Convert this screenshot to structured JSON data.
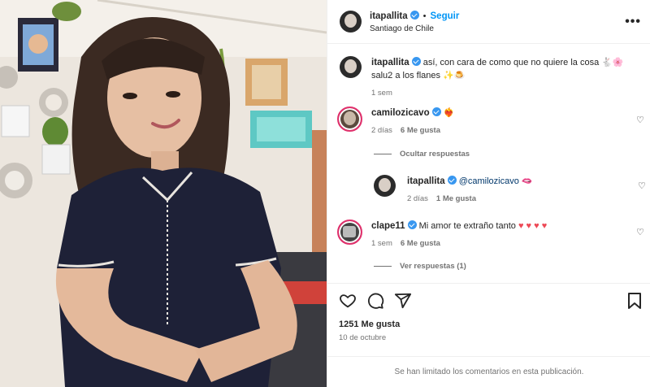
{
  "post": {
    "username": "itapallita",
    "follow_label": "Seguir",
    "location": "Santiago de Chile",
    "more_label": "•••"
  },
  "caption": {
    "username": "itapallita",
    "text_line1": "así, con cara de como que no quiere la cosa 🐇🌸",
    "text_line2": "salu2 a los flanes ✨🍮",
    "time": "1 sem"
  },
  "comments": [
    {
      "username": "camilozicavo",
      "text": "❤️‍🔥",
      "time": "2 días",
      "likes": "6 Me gusta",
      "replies_label": "Ocultar respuestas"
    },
    {
      "username": "itapallita",
      "mention": "@camilozicavo",
      "text": "🫦",
      "time": "2 días",
      "likes": "1 Me gusta"
    },
    {
      "username": "clape11",
      "text": "Mi amor te extraño tanto",
      "hearts": "♥ ♥ ♥ ♥",
      "time": "1 sem",
      "likes": "6 Me gusta",
      "replies_label": "Ver respuestas (1)"
    }
  ],
  "footer": {
    "likes": "1251 Me gusta",
    "date": "10 de octubre",
    "limited_notice": "Se han limitado los comentarios en esta publicación."
  },
  "icons": [
    "heart-icon",
    "comment-icon",
    "share-icon",
    "save-icon",
    "verified-icon",
    "more-icon"
  ],
  "colors": {
    "accent": "#0095f6",
    "verified": "#3897f0",
    "muted": "#737373",
    "like_red": "#ed4956"
  }
}
